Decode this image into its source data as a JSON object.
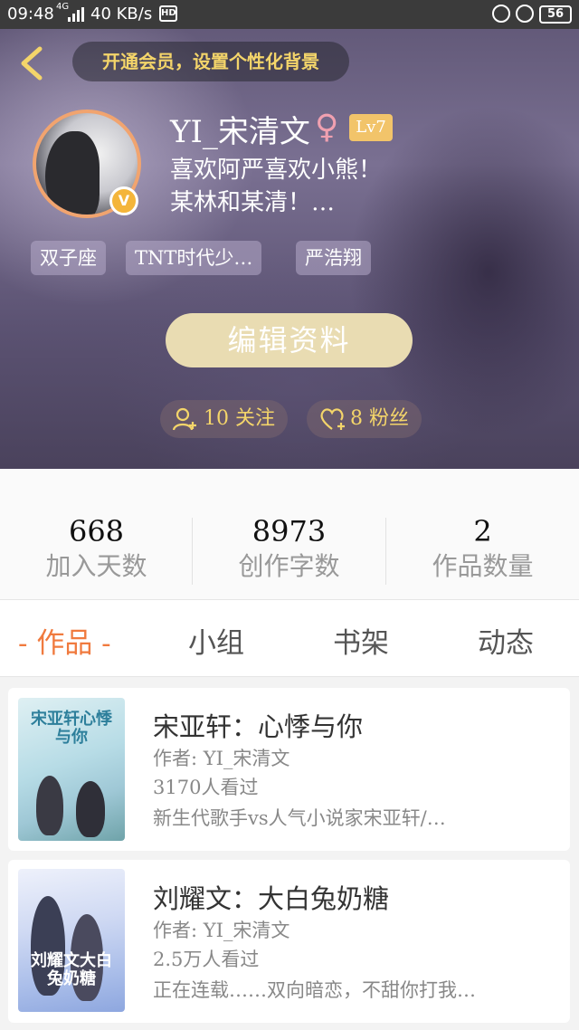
{
  "status_bar": {
    "time": "09:48",
    "network": "4G",
    "speed": "40 KB/s",
    "hd": "HD",
    "battery": "56"
  },
  "header": {
    "vip_banner": "开通会员，设置个性化背景"
  },
  "profile": {
    "username": "YI_宋清文",
    "gender_symbol": "♀",
    "level": "Lv7",
    "verified_badge": "V",
    "bio_line1": "喜欢阿严喜欢小熊！",
    "bio_line2": "某林和某清！…",
    "tags": [
      "双子座",
      "TNT时代少…",
      "严浩翔"
    ],
    "edit_button": "编辑资料",
    "following": "10 关注",
    "followers": "8 粉丝"
  },
  "stats": [
    {
      "value": "668",
      "label": "加入天数"
    },
    {
      "value": "8973",
      "label": "创作字数"
    },
    {
      "value": "2",
      "label": "作品数量"
    }
  ],
  "tabs": {
    "works": "- 作品 -",
    "group": "小组",
    "bookshelf": "书架",
    "activity": "动态"
  },
  "works": [
    {
      "title": "宋亚轩：心悸与你",
      "author": "作者: YI_宋清文",
      "views": "3170人看过",
      "desc": "新生代歌手vs人气小说家宋亚轩/…",
      "cover_text": "宋亚轩心悸与你"
    },
    {
      "title": "刘耀文：大白兔奶糖",
      "author": "作者: YI_宋清文",
      "views": "2.5万人看过",
      "desc": "正在连载……双向暗恋，不甜你打我…",
      "cover_text": "刘耀文大白兔奶糖"
    }
  ]
}
